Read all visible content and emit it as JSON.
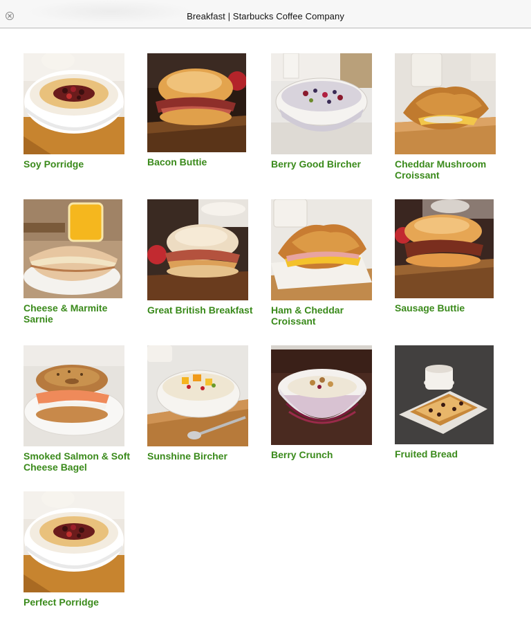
{
  "window": {
    "title": "Breakfast | Starbucks Coffee Company"
  },
  "menu_items": [
    {
      "label": "Soy Porridge",
      "icon": "porridge-bowl-image",
      "accent": "#f2c56b"
    },
    {
      "label": "Bacon Buttie",
      "icon": "bacon-roll-image",
      "accent": "#d9964a"
    },
    {
      "label": "Berry Good Bircher",
      "icon": "bircher-glass-bowl-image",
      "accent": "#9c2b4a"
    },
    {
      "label": "Cheddar Mushroom Croissant",
      "icon": "croissant-image",
      "accent": "#d9964a"
    },
    {
      "label": "Cheese & Marmite Sarnie",
      "icon": "panini-image",
      "accent": "#e8c48d"
    },
    {
      "label": "Great British Breakfast",
      "icon": "breakfast-roll-image",
      "accent": "#e2b56f"
    },
    {
      "label": "Ham & Cheddar Croissant",
      "icon": "ham-croissant-image",
      "accent": "#d9964a"
    },
    {
      "label": "Sausage Buttie",
      "icon": "sausage-roll-image",
      "accent": "#cf8e46"
    },
    {
      "label": "Smoked Salmon & Soft Cheese Bagel",
      "icon": "bagel-image",
      "accent": "#c88a4a"
    },
    {
      "label": "Sunshine Bircher",
      "icon": "sunshine-bircher-image",
      "accent": "#f0c030"
    },
    {
      "label": "Berry Crunch",
      "icon": "berry-crunch-image",
      "accent": "#c46c8c"
    },
    {
      "label": "Fruited Bread",
      "icon": "fruited-bread-image",
      "accent": "#d9a24c"
    },
    {
      "label": "Perfect Porridge",
      "icon": "porridge-bowl-image",
      "accent": "#f2c56b"
    }
  ]
}
